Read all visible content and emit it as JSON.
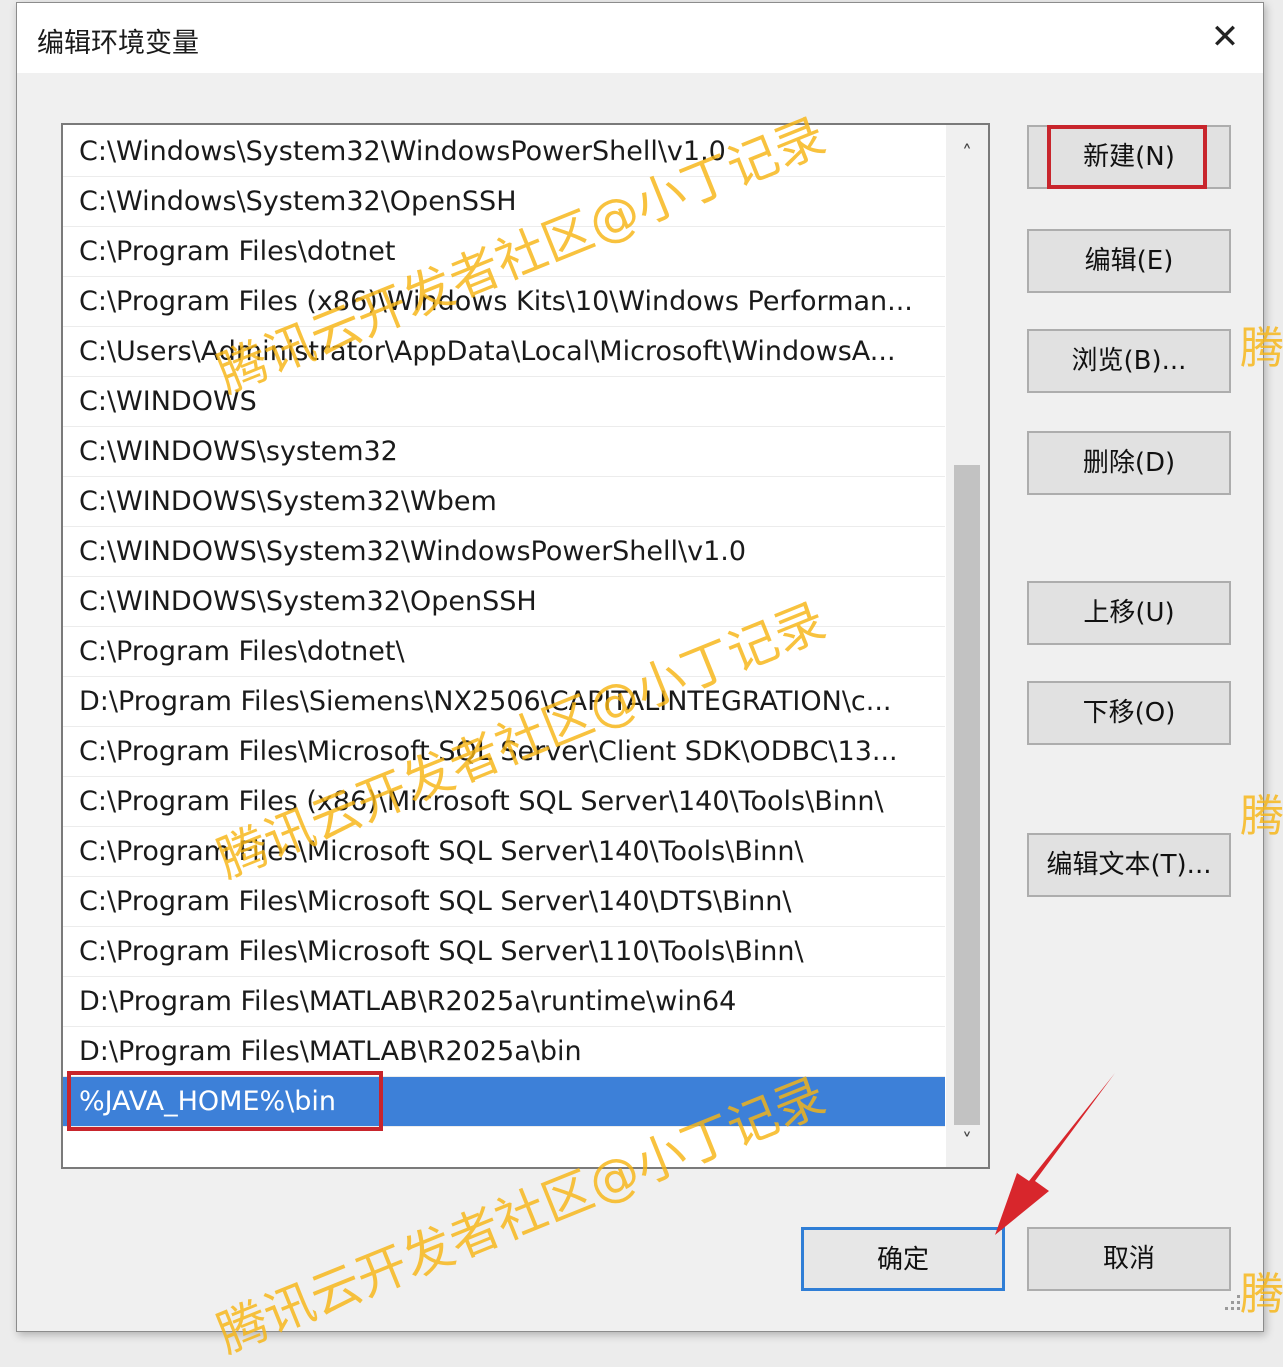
{
  "dialog": {
    "title": "编辑环境变量",
    "close_glyph": "✕"
  },
  "path_list": {
    "items": [
      "C:\\Windows\\System32\\WindowsPowerShell\\v1.0",
      "C:\\Windows\\System32\\OpenSSH",
      "C:\\Program Files\\dotnet",
      "C:\\Program Files (x86)\\Windows Kits\\10\\Windows Performan...",
      "C:\\Users\\Administrator\\AppData\\Local\\Microsoft\\WindowsA...",
      "C:\\WINDOWS",
      "C:\\WINDOWS\\system32",
      "C:\\WINDOWS\\System32\\Wbem",
      "C:\\WINDOWS\\System32\\WindowsPowerShell\\v1.0",
      "C:\\WINDOWS\\System32\\OpenSSH",
      "C:\\Program Files\\dotnet\\",
      "D:\\Program Files\\Siemens\\NX2506\\CAPITALINTEGRATION\\c...",
      "C:\\Program Files\\Microsoft SQL Server\\Client SDK\\ODBC\\13...",
      "C:\\Program Files (x86)\\Microsoft SQL Server\\140\\Tools\\Binn\\",
      "C:\\Program Files\\Microsoft SQL Server\\140\\Tools\\Binn\\",
      "C:\\Program Files\\Microsoft SQL Server\\140\\DTS\\Binn\\",
      "C:\\Program Files\\Microsoft SQL Server\\110\\Tools\\Binn\\",
      "D:\\Program Files\\MATLAB\\R2025a\\runtime\\win64",
      "D:\\Program Files\\MATLAB\\R2025a\\bin",
      "%JAVA_HOME%\\bin"
    ],
    "selected_index": 19,
    "scroll_up_glyph": "˄",
    "scroll_down_glyph": "˅"
  },
  "buttons": {
    "new": "新建(N)",
    "edit": "编辑(E)",
    "browse": "浏览(B)...",
    "delete": "删除(D)",
    "move_up": "上移(U)",
    "move_down": "下移(O)",
    "edit_text": "编辑文本(T)...",
    "ok": "确定",
    "cancel": "取消"
  },
  "watermark": {
    "text": "腾讯云开发者社区@小丁记录",
    "edge_text": "腾"
  },
  "colors": {
    "selection": "#3d80d8",
    "highlight_box": "#c8252c",
    "watermark": "#f7b414",
    "primary_border": "#2f7ed6"
  }
}
